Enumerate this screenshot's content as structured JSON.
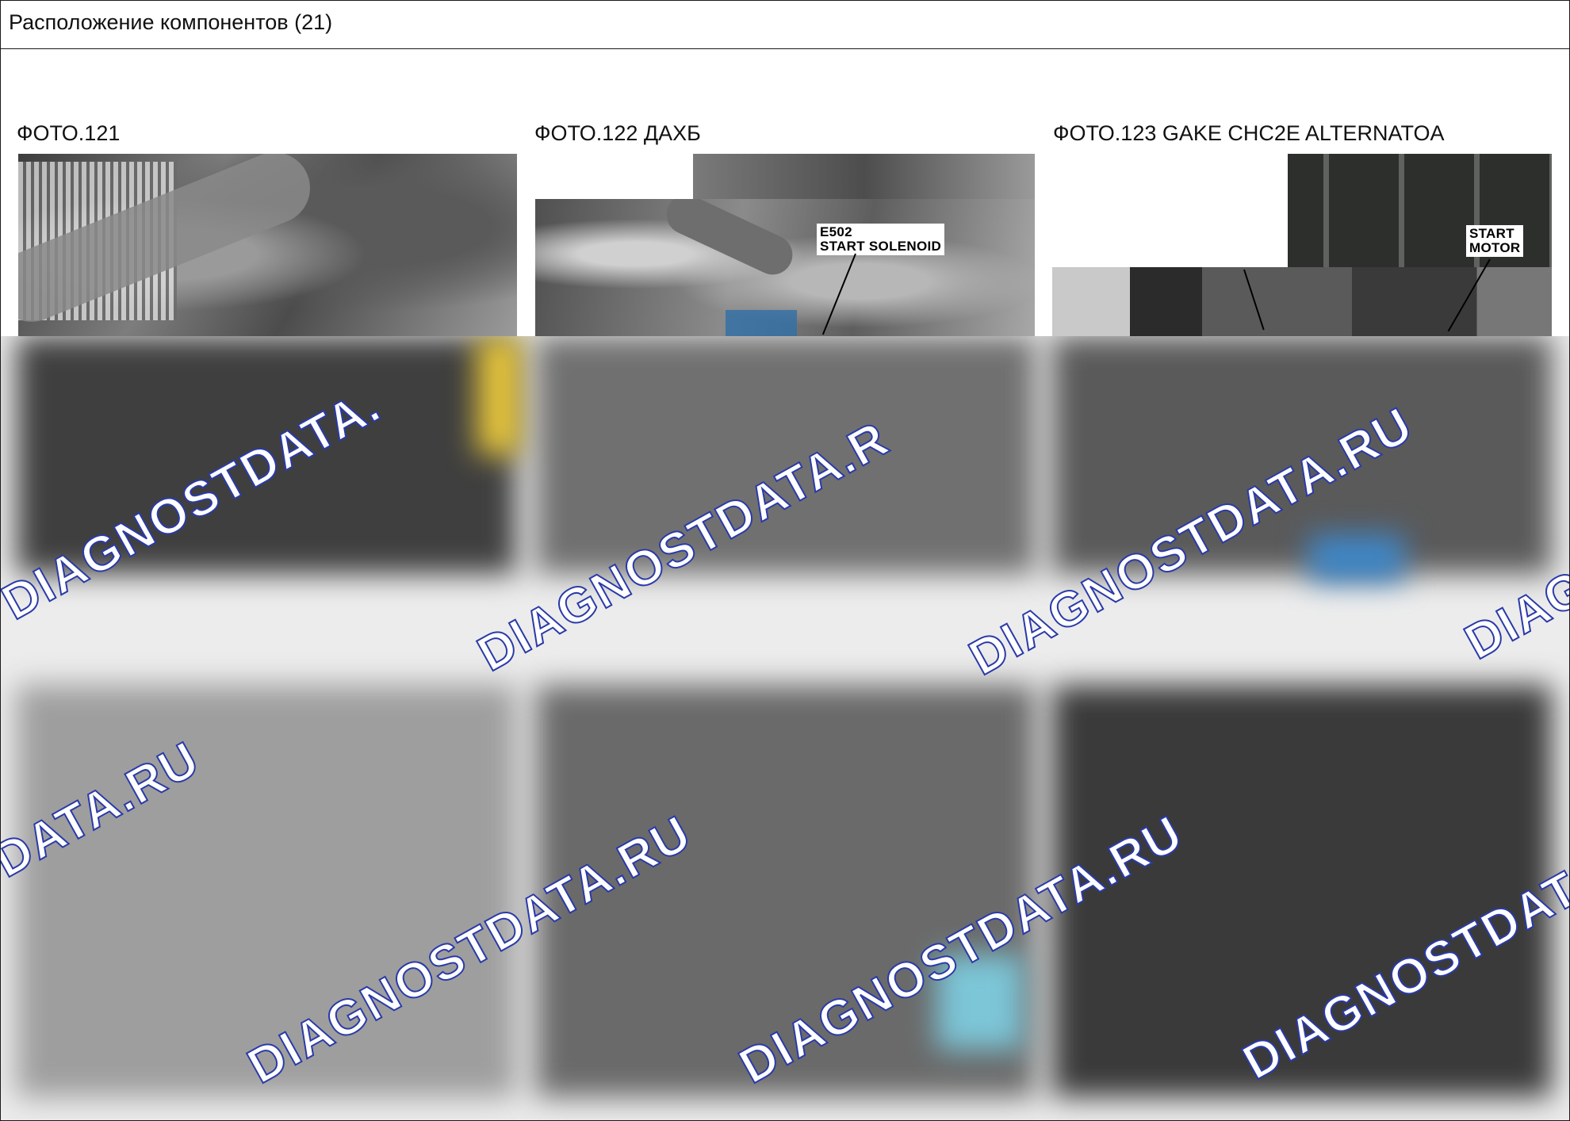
{
  "header": {
    "title": "Расположение компонентов (21)"
  },
  "photos": [
    {
      "caption": "ФОТО.121",
      "labels": []
    },
    {
      "caption": "ФОТО.122 ДАХБ",
      "labels": [
        "E502",
        "START SOLENOID"
      ]
    },
    {
      "caption": "ФОТО.123 GAKE CHC2E ALTERNATOA",
      "labels": [
        "START",
        "MOTOR"
      ]
    }
  ],
  "watermark": {
    "text_full": "DIAGNOSTDATA.RU",
    "text_partial_1": "DIAGNOSTDATA.",
    "text_partial_2": "DATA.RU",
    "text_partial_3": "DIAGNOSTDATA.R",
    "text_partial_4": "DIAG",
    "text_partial_5": "DIAGNOSTDAT",
    "text_partial_6": "DIAGNOSTDATA.RU",
    "color_fill": "#ffffff",
    "color_stroke": "#2a3aa8"
  }
}
